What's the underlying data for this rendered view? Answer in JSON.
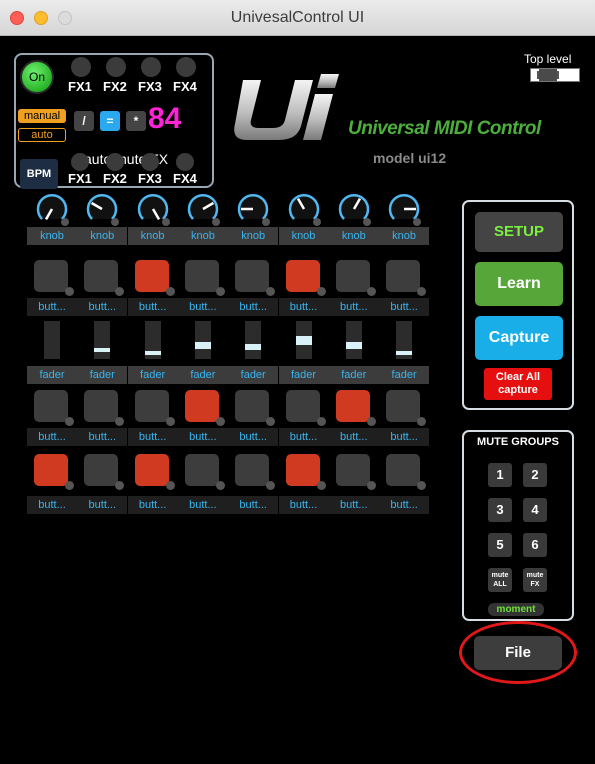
{
  "window": {
    "title": "UnivesalControl UI"
  },
  "top_panel": {
    "on_label": "On",
    "fx_top": [
      "FX1",
      "FX2",
      "FX3",
      "FX4"
    ],
    "fx_bottom": [
      "FX1",
      "FX2",
      "FX3",
      "FX4"
    ],
    "manual_label": "manual",
    "auto_label": "auto",
    "slash_label": "/",
    "equals_label": "=",
    "star_label": "*",
    "value": "84",
    "auto_mute_label": "auto mute FX",
    "bpm_label": "BPM"
  },
  "logo": {
    "text": "Ui",
    "brand": "Universal MIDI Control",
    "model": "model ui12"
  },
  "top_level": {
    "label": "Top level"
  },
  "grid": {
    "knob_label": "knob",
    "button_label": "butt...",
    "fader_label": "fader",
    "columns": 8,
    "knob_angles": [
      -150,
      -60,
      150,
      60,
      -90,
      -30,
      30,
      90
    ],
    "row1_pads": [
      false,
      false,
      true,
      false,
      false,
      true,
      false,
      false
    ],
    "fader_levels": [
      0.0,
      0.25,
      0.15,
      0.4,
      0.35,
      0.55,
      0.4,
      0.15
    ],
    "row2_pads": [
      false,
      false,
      false,
      true,
      false,
      false,
      true,
      false
    ],
    "row3_pads": [
      true,
      false,
      true,
      false,
      false,
      true,
      false,
      false
    ]
  },
  "right_panel": {
    "setup": "SETUP",
    "learn": "Learn",
    "capture": "Capture",
    "clear_line1": "Clear All",
    "clear_line2": "capture"
  },
  "mute_groups": {
    "title": "MUTE GROUPS",
    "buttons": [
      "1",
      "2",
      "3",
      "4",
      "5",
      "6"
    ],
    "mute_all": [
      "mute",
      "ALL"
    ],
    "mute_fx": [
      "mute",
      "FX"
    ],
    "moment": "moment"
  },
  "file": {
    "label": "File"
  },
  "colors": {
    "accent_red": "#cf3a20",
    "accent_green": "#57a63a",
    "accent_blue": "#19aee8",
    "magenta": "#ff23d6"
  }
}
